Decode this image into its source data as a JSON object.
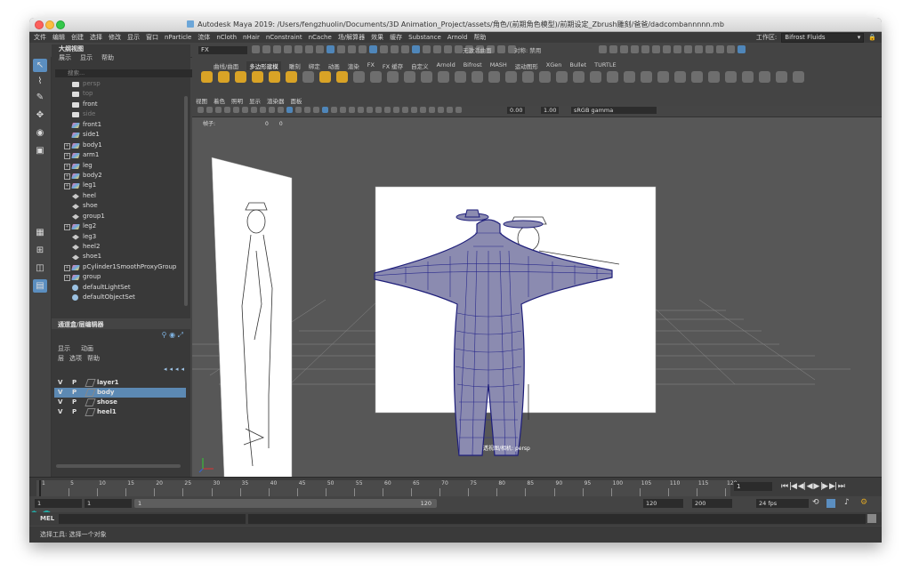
{
  "window": {
    "title": "Autodesk Maya 2019: /Users/fengzhuolin/Documents/3D Animation_Project/assets/角色/(前期角色模型)/前期设定_Zbrush雕刻/爸爸/dadcombannnnn.mb"
  },
  "menubar": {
    "items": [
      "文件",
      "编辑",
      "创建",
      "选择",
      "修改",
      "显示",
      "窗口",
      "nParticle",
      "流体",
      "nCloth",
      "nHair",
      "nConstraint",
      "nCache",
      "场/解算器",
      "效果",
      "缓存",
      "Substance",
      "Arnold",
      "帮助"
    ],
    "workspace_label": "工作区:",
    "workspace_value": "Bifrost Fluids"
  },
  "toolbar": {
    "mode": "FX",
    "no_live_surface": "无激活曲面",
    "symmetry_label": "对称: 禁用"
  },
  "outliner": {
    "title": "大纲视图",
    "menu": [
      "展示",
      "显示",
      "帮助"
    ],
    "search_placeholder": "搜索...",
    "items": [
      {
        "label": "persp",
        "icon": "camera-icon",
        "dim": true,
        "expand": false
      },
      {
        "label": "top",
        "icon": "camera-icon",
        "dim": true,
        "expand": false
      },
      {
        "label": "front",
        "icon": "camera-icon",
        "dim": false,
        "expand": false
      },
      {
        "label": "side",
        "icon": "camera-icon",
        "dim": true,
        "expand": false
      },
      {
        "label": "front1",
        "icon": "mesh-icon",
        "dim": false,
        "expand": false
      },
      {
        "label": "side1",
        "icon": "mesh-icon",
        "dim": false,
        "expand": false
      },
      {
        "label": "body1",
        "icon": "mesh-icon",
        "dim": false,
        "expand": true
      },
      {
        "label": "arm1",
        "icon": "mesh-icon",
        "dim": false,
        "expand": true
      },
      {
        "label": "leg",
        "icon": "mesh-icon",
        "dim": false,
        "expand": true
      },
      {
        "label": "body2",
        "icon": "mesh-icon",
        "dim": false,
        "expand": true
      },
      {
        "label": "leg1",
        "icon": "mesh-icon",
        "dim": false,
        "expand": true
      },
      {
        "label": "heel",
        "icon": "node-icon",
        "dim": false,
        "expand": false
      },
      {
        "label": "shoe",
        "icon": "node-icon",
        "dim": false,
        "expand": false
      },
      {
        "label": "group1",
        "icon": "node-icon",
        "dim": false,
        "expand": false
      },
      {
        "label": "leg2",
        "icon": "mesh-icon",
        "dim": false,
        "expand": true
      },
      {
        "label": "leg3",
        "icon": "node-icon",
        "dim": false,
        "expand": false
      },
      {
        "label": "heel2",
        "icon": "node-icon",
        "dim": false,
        "expand": false
      },
      {
        "label": "shoe1",
        "icon": "node-icon",
        "dim": false,
        "expand": false
      },
      {
        "label": "pCylinder1SmoothProxyGroup",
        "icon": "mesh-icon",
        "dim": false,
        "expand": true
      },
      {
        "label": "group",
        "icon": "mesh-icon",
        "dim": false,
        "expand": true
      },
      {
        "label": "defaultLightSet",
        "icon": "set-icon",
        "dim": false,
        "expand": false
      },
      {
        "label": "defaultObjectSet",
        "icon": "set-icon",
        "dim": false,
        "expand": false
      }
    ]
  },
  "channel_box": {
    "title": "通道盒/层编辑器",
    "tabs": [
      "显示",
      "动画"
    ],
    "menu": [
      "层",
      "选项",
      "帮助"
    ],
    "layers": [
      {
        "v": "V",
        "p": "P",
        "name": "layer1",
        "selected": false
      },
      {
        "v": "V",
        "p": "P",
        "name": "body",
        "selected": true
      },
      {
        "v": "V",
        "p": "P",
        "name": "shose",
        "selected": false
      },
      {
        "v": "V",
        "p": "P",
        "name": "heel1",
        "selected": false
      }
    ]
  },
  "shelf": {
    "tabs": [
      "曲线/曲面",
      "多边形建模",
      "雕刻",
      "绑定",
      "动画",
      "渲染",
      "FX",
      "FX 缓存",
      "自定义",
      "Arnold",
      "Bifrost",
      "MASH",
      "运动图形",
      "XGen",
      "Bullet",
      "TURTLE"
    ],
    "active_tab": "多边形建模"
  },
  "panel": {
    "menu": [
      "视图",
      "着色",
      "照明",
      "显示",
      "渲染器",
      "面板"
    ],
    "exposure": "0.00",
    "gamma": "1.00",
    "colorspace": "sRGB gamma",
    "hud_label": "帧子:",
    "hud_values": [
      "0",
      "0"
    ],
    "camera_label": "透视图/相机: persp"
  },
  "timeline": {
    "ticks": [
      "1",
      "5",
      "10",
      "15",
      "20",
      "25",
      "30",
      "35",
      "40",
      "45",
      "50",
      "55",
      "60",
      "65",
      "70",
      "75",
      "80",
      "85",
      "90",
      "95",
      "100",
      "105",
      "110",
      "115",
      "120"
    ],
    "current_frame": "1",
    "playback_controls": "⏮ |◀ ◀| ◀ ▶ |▶ ▶| ⏭"
  },
  "range": {
    "start": "1",
    "playback_start": "1",
    "slider_start": "1",
    "slider_end": "120",
    "playback_end": "120",
    "end": "200",
    "fps": "24 fps"
  },
  "mel": {
    "label": "MEL"
  },
  "help_line": "选择工具: 选择一个对象",
  "colors": {
    "accent": "#5b8ec0",
    "selected_layer": "#5c89b3",
    "wire": "#2a2a8c"
  }
}
